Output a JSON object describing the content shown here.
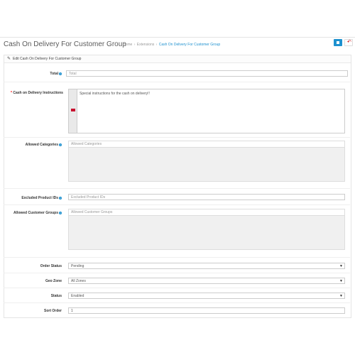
{
  "header": {
    "title": "Cash On Delivery For Customer Group",
    "breadcrumb": [
      "Home",
      "Extensions",
      "Cash On Delivery For Customer Group"
    ],
    "save_icon": "save-icon",
    "back_icon": "reply-icon"
  },
  "panel": {
    "heading": "Edit Cash On Delivery For Customer Group",
    "heading_icon": "pencil-icon"
  },
  "form": {
    "total": {
      "label": "Total",
      "placeholder": "Total"
    },
    "instructions": {
      "label": "Cash on Delivery Instructions",
      "value": "Special instructions for the cash on delivery!!",
      "language_flag": "uk-flag-icon"
    },
    "categories": {
      "label": "Allowed Categories",
      "placeholder": "Allowed Categories"
    },
    "excluded_products": {
      "label": "Excluded Product IDs",
      "placeholder": "Excluded Product IDs"
    },
    "customer_groups": {
      "label": "Allowed Customer Groups",
      "placeholder": "Allowed Customer Groups"
    },
    "order_status": {
      "label": "Order Status",
      "value": "Pending"
    },
    "geo_zone": {
      "label": "Geo Zone",
      "value": "All Zones"
    },
    "status": {
      "label": "Status",
      "value": "Enabled"
    },
    "sort_order": {
      "label": "Sort Order",
      "value": "1"
    }
  },
  "colors": {
    "accent": "#1e91cf",
    "required": "#ff0000",
    "back": "#cc0000"
  }
}
